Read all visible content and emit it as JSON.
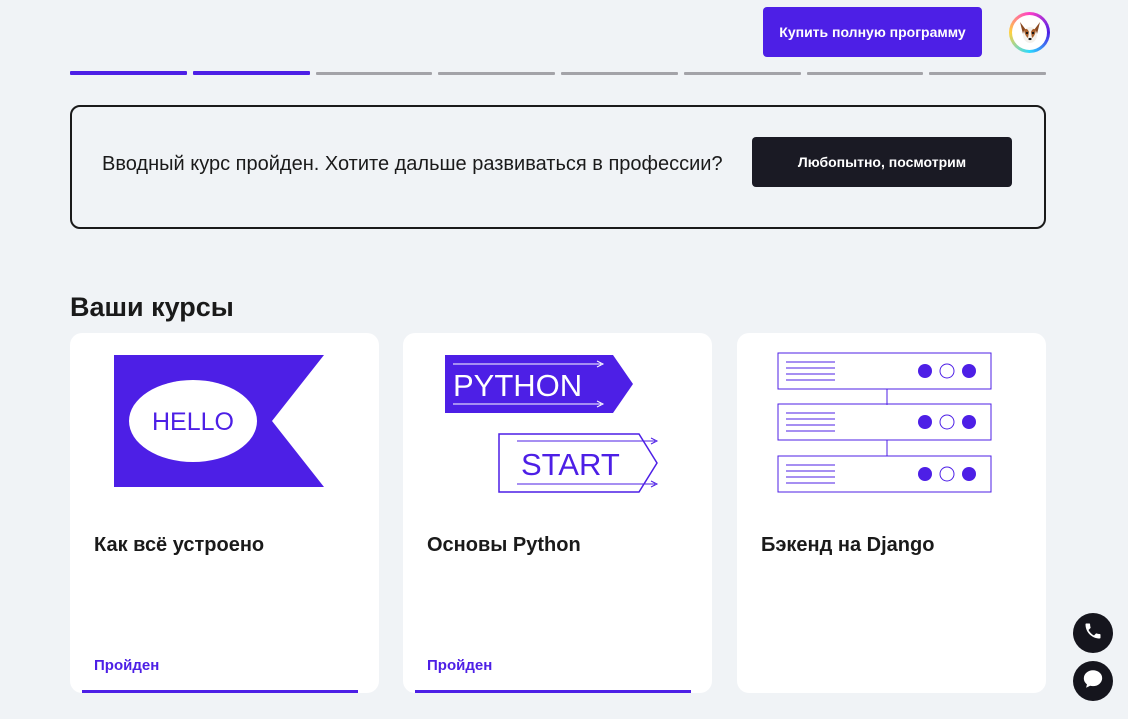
{
  "header": {
    "buy_button_label": "Купить полную программу",
    "avatar_icon": "dog-avatar-icon"
  },
  "progress": {
    "total_segments": 8,
    "completed_segments": 2,
    "completed_color": "#4d1fe6",
    "pending_color": "#a3a3a8"
  },
  "banner": {
    "text": "Вводный курс пройден. Хотите дальше развиваться в профессии?",
    "button_label": "Любопытно, посмотрим"
  },
  "courses_section": {
    "title": "Ваши курсы",
    "courses": [
      {
        "title": "Как всё устроено",
        "status": "Пройден",
        "art_icon": "hello-flag-icon",
        "art_text": "HELLO"
      },
      {
        "title": "Основы Python",
        "status": "Пройден",
        "art_icon": "python-start-arrows-icon",
        "art_text_1": "PYTHON",
        "art_text_2": "START"
      },
      {
        "title": "Бэкенд на Django",
        "status": "",
        "art_icon": "server-stack-icon"
      }
    ]
  },
  "floating": {
    "call_icon": "phone-icon",
    "chat_icon": "chat-bubble-icon"
  },
  "colors": {
    "accent": "#4d1fe6",
    "background": "#f0f3f6",
    "dark": "#1a1a24"
  }
}
